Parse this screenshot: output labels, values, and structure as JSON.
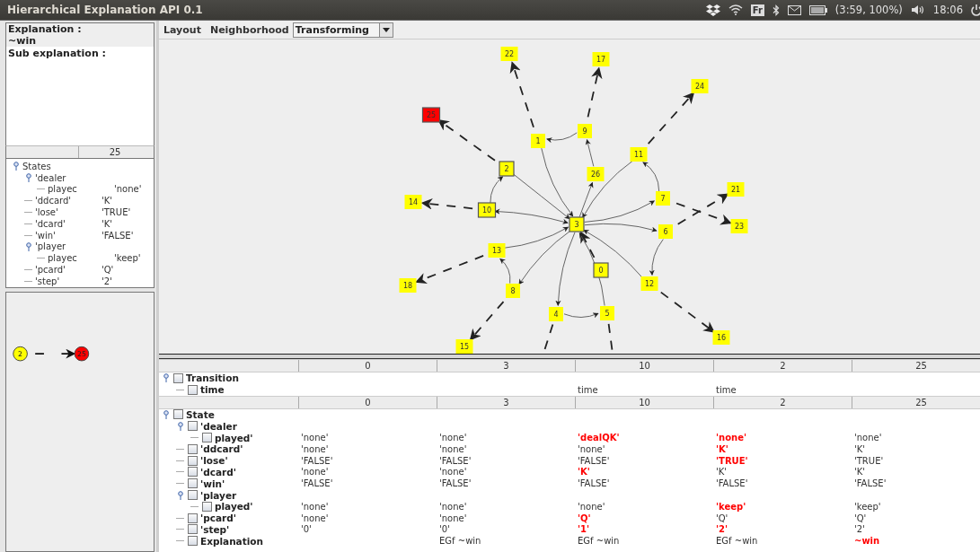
{
  "window": {
    "title": "Hierarchical Explanation API 0.1"
  },
  "tray": {
    "keyboard": "Fr",
    "battery": "(3:59, 100%)",
    "clock": "18:06"
  },
  "explanation": {
    "label": "Explanation :",
    "value": "~win",
    "sub_label": "Sub explanation :"
  },
  "states_table": {
    "columns": [
      "25"
    ]
  },
  "states_tree": {
    "label": "States",
    "expanded": true,
    "children": [
      {
        "label": "'dealer",
        "expanded": true,
        "children": [
          {
            "label": "playec",
            "value": "'none'"
          }
        ]
      },
      {
        "label": "'ddcard'",
        "value": "'K'"
      },
      {
        "label": "'lose'",
        "value": "'TRUE'"
      },
      {
        "label": "'dcard'",
        "value": "'K'"
      },
      {
        "label": "'win'",
        "value": "'FALSE'"
      },
      {
        "label": "'player",
        "expanded": true,
        "children": [
          {
            "label": "playec",
            "value": "'keep'"
          }
        ]
      },
      {
        "label": "'pcard'",
        "value": "'Q'"
      },
      {
        "label": "'step'",
        "value": "'2'"
      }
    ]
  },
  "mini_graph": {
    "nodes": [
      {
        "label": "2",
        "color": "#ffff00"
      },
      {
        "label": "25",
        "color": "#ff0000"
      }
    ]
  },
  "toolbar": {
    "layout": "Layout",
    "neighborhood": "Neighborhood",
    "combo": {
      "value": "Transforming"
    }
  },
  "graph": {
    "nodes": [
      {
        "label": "22",
        "color": "#ffff00",
        "outlined": false
      },
      {
        "label": "17",
        "color": "#ffff00",
        "outlined": false
      },
      {
        "label": "24",
        "color": "#ffff00",
        "outlined": false
      },
      {
        "label": "25",
        "color": "#ff0000",
        "outlined": true
      },
      {
        "label": "9",
        "color": "#ffff00",
        "outlined": false
      },
      {
        "label": "1",
        "color": "#ffff00",
        "outlined": false
      },
      {
        "label": "11",
        "color": "#ffff00",
        "outlined": false
      },
      {
        "label": "2",
        "color": "#ffff00",
        "outlined": true
      },
      {
        "label": "26",
        "color": "#ffff00",
        "outlined": false
      },
      {
        "label": "14",
        "color": "#ffff00",
        "outlined": false
      },
      {
        "label": "21",
        "color": "#ffff00",
        "outlined": false
      },
      {
        "label": "7",
        "color": "#ffff00",
        "outlined": false
      },
      {
        "label": "10",
        "color": "#ffff00",
        "outlined": true
      },
      {
        "label": "3",
        "color": "#ffff00",
        "outlined": true
      },
      {
        "label": "23",
        "color": "#ffff00",
        "outlined": false
      },
      {
        "label": "6",
        "color": "#ffff00",
        "outlined": false
      },
      {
        "label": "13",
        "color": "#ffff00",
        "outlined": false
      },
      {
        "label": "0",
        "color": "#ffff00",
        "outlined": true
      },
      {
        "label": "18",
        "color": "#ffff00",
        "outlined": false
      },
      {
        "label": "8",
        "color": "#ffff00",
        "outlined": false
      },
      {
        "label": "12",
        "color": "#ffff00",
        "outlined": false
      },
      {
        "label": "4",
        "color": "#ffff00",
        "outlined": false
      },
      {
        "label": "5",
        "color": "#ffff00",
        "outlined": false
      },
      {
        "label": "16",
        "color": "#ffff00",
        "outlined": false
      },
      {
        "label": "15",
        "color": "#ffff00",
        "outlined": false
      }
    ]
  },
  "table": {
    "transition": {
      "columns": [
        "0",
        "3",
        "10",
        "2",
        "25"
      ],
      "tree": {
        "label": "Transition",
        "checked": false,
        "expanded": true,
        "children": [
          {
            "label": "time",
            "checked": false,
            "cells": [
              null,
              null,
              {
                "text": "time",
                "changed": false
              },
              {
                "text": "time",
                "changed": false
              },
              null
            ]
          }
        ]
      }
    },
    "state": {
      "columns": [
        "0",
        "3",
        "10",
        "2",
        "25"
      ],
      "tree": {
        "label": "State",
        "checked": false,
        "expanded": true,
        "children": [
          {
            "label": "'dealer",
            "checked": false,
            "expanded": true,
            "children": [
              {
                "label": "played'",
                "checked": false,
                "cells": [
                  {
                    "text": "'none'",
                    "changed": false
                  },
                  {
                    "text": "'none'",
                    "changed": false
                  },
                  {
                    "text": "'dealQK'",
                    "changed": true
                  },
                  {
                    "text": "'none'",
                    "changed": true
                  },
                  {
                    "text": "'none'",
                    "changed": false
                  }
                ]
              }
            ]
          },
          {
            "label": "'ddcard'",
            "checked": false,
            "cells": [
              {
                "text": "'none'",
                "changed": false
              },
              {
                "text": "'none'",
                "changed": false
              },
              {
                "text": "'none'",
                "changed": false
              },
              {
                "text": "'K'",
                "changed": true
              },
              {
                "text": "'K'",
                "changed": false
              }
            ]
          },
          {
            "label": "'lose'",
            "checked": false,
            "cells": [
              {
                "text": "'FALSE'",
                "changed": false
              },
              {
                "text": "'FALSE'",
                "changed": false
              },
              {
                "text": "'FALSE'",
                "changed": false
              },
              {
                "text": "'TRUE'",
                "changed": true
              },
              {
                "text": "'TRUE'",
                "changed": false
              }
            ]
          },
          {
            "label": "'dcard'",
            "checked": false,
            "cells": [
              {
                "text": "'none'",
                "changed": false
              },
              {
                "text": "'none'",
                "changed": false
              },
              {
                "text": "'K'",
                "changed": true
              },
              {
                "text": "'K'",
                "changed": false
              },
              {
                "text": "'K'",
                "changed": false
              }
            ]
          },
          {
            "label": "'win'",
            "checked": false,
            "cells": [
              {
                "text": "'FALSE'",
                "changed": false
              },
              {
                "text": "'FALSE'",
                "changed": false
              },
              {
                "text": "'FALSE'",
                "changed": false
              },
              {
                "text": "'FALSE'",
                "changed": false
              },
              {
                "text": "'FALSE'",
                "changed": false
              }
            ]
          },
          {
            "label": "'player",
            "checked": false,
            "expanded": true,
            "children": [
              {
                "label": "played'",
                "checked": false,
                "cells": [
                  {
                    "text": "'none'",
                    "changed": false
                  },
                  {
                    "text": "'none'",
                    "changed": false
                  },
                  {
                    "text": "'none'",
                    "changed": false
                  },
                  {
                    "text": "'keep'",
                    "changed": true
                  },
                  {
                    "text": "'keep'",
                    "changed": false
                  }
                ]
              }
            ]
          },
          {
            "label": "'pcard'",
            "checked": false,
            "cells": [
              {
                "text": "'none'",
                "changed": false
              },
              {
                "text": "'none'",
                "changed": false
              },
              {
                "text": "'Q'",
                "changed": true
              },
              {
                "text": "'Q'",
                "changed": false
              },
              {
                "text": "'Q'",
                "changed": false
              }
            ]
          },
          {
            "label": "'step'",
            "checked": false,
            "cells": [
              {
                "text": "'0'",
                "changed": false
              },
              {
                "text": "'0'",
                "changed": false
              },
              {
                "text": "'1'",
                "changed": true
              },
              {
                "text": "'2'",
                "changed": true
              },
              {
                "text": "'2'",
                "changed": false
              }
            ]
          },
          {
            "label": "Explanation",
            "checked": false,
            "cells": [
              null,
              {
                "text": "EGf ~win",
                "changed": false
              },
              {
                "text": "EGf ~win",
                "changed": false
              },
              {
                "text": "EGf ~win",
                "changed": false
              },
              {
                "text": "~win",
                "changed": true
              }
            ]
          }
        ]
      }
    }
  }
}
